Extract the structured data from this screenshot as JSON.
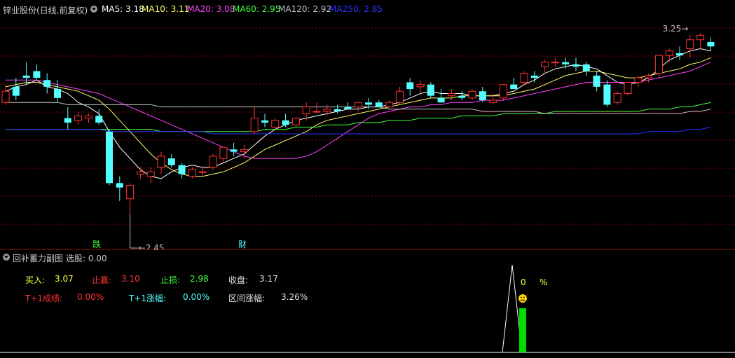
{
  "header": {
    "title": "锌业股份(日线,前复权)",
    "ma": [
      {
        "label": "MA5: 3.18",
        "color": "#ffffff"
      },
      {
        "label": "MA10: 3.11",
        "color": "#ffff66"
      },
      {
        "label": "MA20: 3.08",
        "color": "#ff40ff"
      },
      {
        "label": "MA60: 2.95",
        "color": "#40ff40"
      },
      {
        "label": "MA120: 2.92",
        "color": "#c0c0c0"
      },
      {
        "label": "MA250: 2.85",
        "color": "#3030ff"
      }
    ]
  },
  "price_labels": {
    "high": "3.25",
    "low": "2.45"
  },
  "markers": {
    "die": "跌",
    "cai": "财"
  },
  "sub_panel": {
    "title": "回补蓄力副图",
    "select_label": "选股: 0.00",
    "buy_label": "买入:",
    "buy_value": "3.07",
    "take_profit_label": "止赢:",
    "take_profit_value": "3.10",
    "stop_loss_label": "止损:",
    "stop_loss_value": "2.98",
    "close_label": "收盘:",
    "close_value": "3.17",
    "t1_success_label": "T+1成绩:",
    "t1_success_value": "0.00%",
    "t1_change_label": "T+1涨幅:",
    "t1_change_value": "0.00%",
    "range_change_label": "区间涨幅:",
    "range_change_value": "3.26%",
    "indicator_value": "0",
    "indicator_unit": "%",
    "face_icon": "sad-face-icon"
  },
  "colors": {
    "up": "#ff3232",
    "down": "#54ffff",
    "grid": "#8b0000"
  },
  "chart_data": {
    "type": "candlestick",
    "ylim": [
      2.35,
      3.32
    ],
    "candles": [
      [
        2.95,
        3.03,
        2.94,
        3.0
      ],
      [
        3.02,
        3.06,
        2.96,
        2.98
      ],
      [
        3.07,
        3.13,
        3.03,
        3.06
      ],
      [
        3.09,
        3.12,
        3.05,
        3.06
      ],
      [
        3.05,
        3.08,
        2.99,
        3.02
      ],
      [
        3.01,
        3.05,
        2.95,
        2.97
      ],
      [
        2.88,
        2.93,
        2.83,
        2.86
      ],
      [
        2.87,
        2.91,
        2.85,
        2.89
      ],
      [
        2.88,
        2.9,
        2.86,
        2.89
      ],
      [
        2.89,
        2.92,
        2.85,
        2.86
      ],
      [
        2.82,
        2.83,
        2.58,
        2.59
      ],
      [
        2.59,
        2.62,
        2.51,
        2.57
      ],
      [
        2.52,
        2.59,
        2.45,
        2.58
      ],
      [
        2.63,
        2.66,
        2.61,
        2.64
      ],
      [
        2.62,
        2.66,
        2.59,
        2.64
      ],
      [
        2.66,
        2.73,
        2.63,
        2.71
      ],
      [
        2.7,
        2.72,
        2.66,
        2.67
      ],
      [
        2.67,
        2.68,
        2.61,
        2.63
      ],
      [
        2.62,
        2.66,
        2.61,
        2.65
      ],
      [
        2.64,
        2.66,
        2.62,
        2.64
      ],
      [
        2.66,
        2.72,
        2.65,
        2.71
      ],
      [
        2.7,
        2.75,
        2.68,
        2.75
      ],
      [
        2.74,
        2.77,
        2.71,
        2.73
      ],
      [
        2.73,
        2.76,
        2.7,
        2.74
      ],
      [
        2.82,
        2.93,
        2.81,
        2.88
      ],
      [
        2.87,
        2.9,
        2.84,
        2.86
      ],
      [
        2.84,
        2.88,
        2.83,
        2.87
      ],
      [
        2.87,
        2.9,
        2.84,
        2.85
      ],
      [
        2.85,
        2.88,
        2.84,
        2.88
      ],
      [
        2.9,
        2.95,
        2.87,
        2.93
      ],
      [
        2.91,
        2.95,
        2.9,
        2.91
      ],
      [
        2.91,
        2.94,
        2.89,
        2.92
      ],
      [
        2.92,
        2.94,
        2.9,
        2.91
      ],
      [
        2.93,
        2.95,
        2.92,
        2.92
      ],
      [
        2.93,
        2.95,
        2.91,
        2.95
      ],
      [
        2.95,
        2.97,
        2.92,
        2.94
      ],
      [
        2.95,
        2.96,
        2.93,
        2.93
      ],
      [
        2.93,
        2.96,
        2.92,
        2.95
      ],
      [
        2.95,
        3.02,
        2.94,
        3.0
      ],
      [
        3.04,
        3.06,
        2.98,
        3.01
      ],
      [
        3.02,
        3.05,
        2.99,
        3.03
      ],
      [
        3.03,
        3.04,
        2.97,
        2.98
      ],
      [
        2.97,
        3.01,
        2.95,
        2.95
      ],
      [
        2.98,
        3.01,
        2.96,
        2.99
      ],
      [
        2.98,
        3.0,
        2.96,
        2.97
      ],
      [
        2.97,
        3.01,
        2.96,
        3.0
      ],
      [
        3.0,
        3.02,
        2.95,
        2.96
      ],
      [
        2.95,
        2.99,
        2.94,
        2.96
      ],
      [
        2.97,
        3.03,
        2.96,
        3.03
      ],
      [
        3.03,
        3.06,
        3.01,
        3.01
      ],
      [
        3.04,
        3.09,
        3.03,
        3.08
      ],
      [
        3.07,
        3.09,
        3.04,
        3.06
      ],
      [
        3.11,
        3.14,
        3.08,
        3.13
      ],
      [
        3.13,
        3.15,
        3.11,
        3.13
      ],
      [
        3.13,
        3.15,
        3.1,
        3.12
      ],
      [
        3.12,
        3.15,
        3.09,
        3.11
      ],
      [
        3.12,
        3.13,
        3.07,
        3.09
      ],
      [
        3.07,
        3.09,
        3.0,
        3.02
      ],
      [
        3.03,
        3.05,
        2.93,
        2.94
      ],
      [
        2.95,
        3.0,
        2.94,
        2.99
      ],
      [
        2.99,
        3.04,
        2.98,
        3.04
      ],
      [
        3.04,
        3.07,
        3.02,
        3.06
      ],
      [
        3.06,
        3.08,
        3.04,
        3.07
      ],
      [
        3.08,
        3.16,
        3.06,
        3.16
      ],
      [
        3.16,
        3.19,
        3.13,
        3.18
      ],
      [
        3.17,
        3.2,
        3.14,
        3.16
      ],
      [
        3.19,
        3.25,
        3.15,
        3.23
      ],
      [
        3.23,
        3.26,
        3.19,
        3.25
      ],
      [
        3.22,
        3.24,
        3.18,
        3.2
      ]
    ],
    "ma_lines": [
      {
        "name": "MA5",
        "color": "#ffffff",
        "values": [
          3.0,
          3.02,
          3.03,
          3.05,
          3.02,
          3.01,
          2.99,
          2.95,
          2.93,
          2.9,
          2.82,
          2.75,
          2.7,
          2.65,
          2.62,
          2.61,
          2.64,
          2.66,
          2.67,
          2.66,
          2.66,
          2.68,
          2.7,
          2.72,
          2.76,
          2.8,
          2.83,
          2.85,
          2.87,
          2.88,
          2.89,
          2.9,
          2.91,
          2.92,
          2.92,
          2.93,
          2.93,
          2.94,
          2.95,
          2.97,
          2.99,
          3.0,
          2.99,
          2.99,
          2.99,
          2.98,
          2.98,
          2.98,
          2.99,
          3.0,
          3.03,
          3.05,
          3.08,
          3.1,
          3.11,
          3.12,
          3.11,
          3.1,
          3.07,
          3.04,
          3.03,
          3.04,
          3.06,
          3.1,
          3.14,
          3.16,
          3.18,
          3.19,
          3.18
        ]
      },
      {
        "name": "MA10",
        "color": "#ffff66",
        "values": [
          3.02,
          3.03,
          3.04,
          3.04,
          3.03,
          3.02,
          3.01,
          3.0,
          2.98,
          2.96,
          2.92,
          2.87,
          2.82,
          2.77,
          2.72,
          2.68,
          2.65,
          2.63,
          2.62,
          2.62,
          2.63,
          2.64,
          2.66,
          2.68,
          2.71,
          2.74,
          2.76,
          2.78,
          2.8,
          2.82,
          2.85,
          2.87,
          2.88,
          2.89,
          2.9,
          2.91,
          2.92,
          2.93,
          2.94,
          2.95,
          2.96,
          2.97,
          2.97,
          2.97,
          2.98,
          2.98,
          2.98,
          2.98,
          2.98,
          2.99,
          3.0,
          3.01,
          3.03,
          3.05,
          3.07,
          3.08,
          3.09,
          3.09,
          3.08,
          3.07,
          3.06,
          3.06,
          3.07,
          3.08,
          3.09,
          3.1,
          3.12,
          3.13,
          3.15
        ]
      },
      {
        "name": "MA20",
        "color": "#ff40ff",
        "values": [
          3.05,
          3.05,
          3.05,
          3.05,
          3.04,
          3.03,
          3.02,
          3.01,
          3.0,
          2.99,
          2.97,
          2.95,
          2.93,
          2.91,
          2.89,
          2.87,
          2.85,
          2.83,
          2.81,
          2.79,
          2.77,
          2.75,
          2.73,
          2.71,
          2.7,
          2.7,
          2.7,
          2.7,
          2.7,
          2.71,
          2.73,
          2.76,
          2.79,
          2.82,
          2.85,
          2.88,
          2.9,
          2.91,
          2.92,
          2.93,
          2.93,
          2.94,
          2.94,
          2.95,
          2.95,
          2.95,
          2.96,
          2.96,
          2.96,
          2.97,
          2.98,
          2.99,
          3.0,
          3.01,
          3.02,
          3.03,
          3.04,
          3.04,
          3.04,
          3.04,
          3.04,
          3.04,
          3.05,
          3.06,
          3.07,
          3.08,
          3.09,
          3.11,
          3.13
        ]
      },
      {
        "name": "MA60",
        "color": "#40ff40",
        "values": [
          2.83,
          2.83,
          2.83,
          2.83,
          2.83,
          2.83,
          2.83,
          2.83,
          2.83,
          2.83,
          2.83,
          2.83,
          2.83,
          2.83,
          2.83,
          2.82,
          2.82,
          2.82,
          2.82,
          2.82,
          2.82,
          2.82,
          2.82,
          2.82,
          2.82,
          2.83,
          2.83,
          2.83,
          2.84,
          2.84,
          2.84,
          2.85,
          2.85,
          2.85,
          2.86,
          2.86,
          2.86,
          2.87,
          2.87,
          2.87,
          2.88,
          2.88,
          2.88,
          2.88,
          2.89,
          2.89,
          2.89,
          2.89,
          2.9,
          2.9,
          2.9,
          2.9,
          2.9,
          2.91,
          2.91,
          2.91,
          2.91,
          2.91,
          2.91,
          2.91,
          2.91,
          2.91,
          2.92,
          2.92,
          2.92,
          2.93,
          2.93,
          2.94,
          2.95
        ]
      },
      {
        "name": "MA120",
        "color": "#c0c0c0",
        "values": [
          2.95,
          2.95,
          2.95,
          2.95,
          2.95,
          2.95,
          2.94,
          2.94,
          2.94,
          2.94,
          2.94,
          2.94,
          2.94,
          2.94,
          2.94,
          2.93,
          2.93,
          2.93,
          2.93,
          2.93,
          2.93,
          2.93,
          2.93,
          2.93,
          2.93,
          2.93,
          2.93,
          2.93,
          2.93,
          2.93,
          2.93,
          2.93,
          2.93,
          2.93,
          2.93,
          2.93,
          2.93,
          2.92,
          2.92,
          2.92,
          2.92,
          2.92,
          2.92,
          2.92,
          2.92,
          2.92,
          2.91,
          2.91,
          2.91,
          2.91,
          2.91,
          2.91,
          2.9,
          2.9,
          2.9,
          2.9,
          2.9,
          2.9,
          2.9,
          2.9,
          2.9,
          2.9,
          2.9,
          2.9,
          2.9,
          2.9,
          2.91,
          2.91,
          2.92
        ]
      },
      {
        "name": "MA250",
        "color": "#3030ff",
        "values": [
          2.83,
          2.83,
          2.83,
          2.83,
          2.83,
          2.83,
          2.83,
          2.83,
          2.83,
          2.83,
          2.82,
          2.82,
          2.82,
          2.82,
          2.82,
          2.82,
          2.82,
          2.82,
          2.82,
          2.82,
          2.81,
          2.81,
          2.81,
          2.81,
          2.81,
          2.81,
          2.81,
          2.81,
          2.81,
          2.81,
          2.81,
          2.81,
          2.81,
          2.81,
          2.81,
          2.81,
          2.81,
          2.81,
          2.81,
          2.81,
          2.81,
          2.81,
          2.81,
          2.81,
          2.81,
          2.81,
          2.81,
          2.81,
          2.81,
          2.81,
          2.81,
          2.81,
          2.81,
          2.81,
          2.81,
          2.81,
          2.81,
          2.81,
          2.81,
          2.81,
          2.81,
          2.81,
          2.82,
          2.82,
          2.82,
          2.82,
          2.83,
          2.83,
          2.84
        ]
      }
    ],
    "signal": {
      "value": 0,
      "spike_index": 52
    }
  }
}
